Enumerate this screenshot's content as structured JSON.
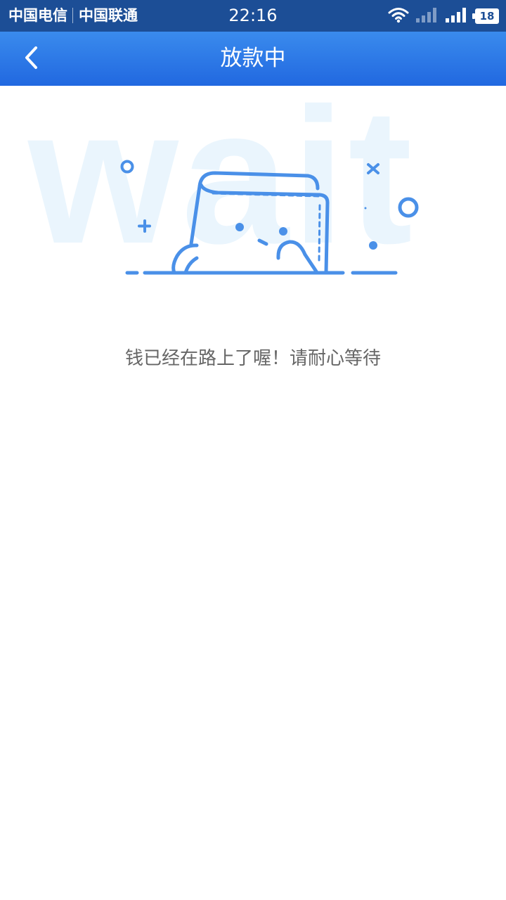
{
  "status_bar": {
    "carrier_1": "中国电信",
    "carrier_2": "中国联通",
    "time": "22:16",
    "battery": "18",
    "icons": [
      "wifi-icon",
      "signal-icon",
      "signal-icon",
      "battery-icon"
    ]
  },
  "nav": {
    "back_icon": "chevron-left-icon",
    "title": "放款中"
  },
  "illustration": {
    "background_word": "wait",
    "accent_color": "#4a90e8"
  },
  "message": "钱已经在路上了喔！请耐心等待",
  "colors": {
    "status_bar": "#1c4e96",
    "nav_bar": "#2f7ce8",
    "watermark": "#eaf5fd",
    "text": "#666666"
  }
}
